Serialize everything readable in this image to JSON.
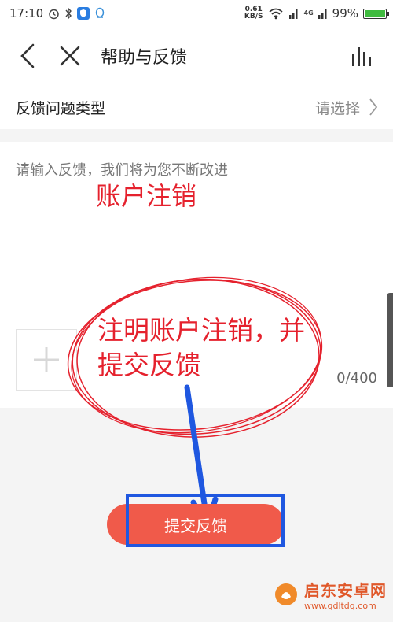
{
  "status_bar": {
    "time": "17:10",
    "net_speed_value": "0.61",
    "net_speed_unit": "KB/S",
    "network_label": "4G",
    "battery": "99%",
    "battery_level": 0.99
  },
  "header": {
    "title": "帮助与反馈"
  },
  "feedback_type": {
    "label": "反馈问题类型",
    "value": "请选择"
  },
  "feedback": {
    "placeholder": "请输入反馈，我们将为您不断改进",
    "char_count": "0/400"
  },
  "annotations": {
    "top": "账户注销",
    "middle": "注明账户注销，并提交反馈"
  },
  "submit": {
    "label": "提交反馈"
  },
  "watermark": {
    "name": "启东安卓网",
    "url": "www.qdltdq.com"
  },
  "colors": {
    "accent": "#f05a4a",
    "annotation_red": "#e5212d",
    "annotation_blue": "#1f57e0"
  }
}
